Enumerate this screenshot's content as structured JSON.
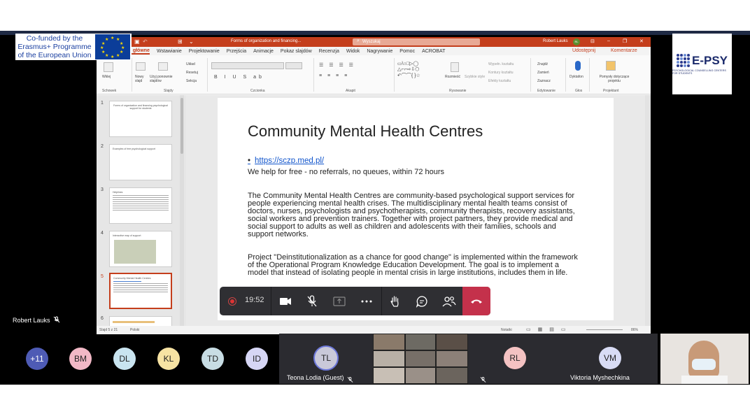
{
  "logos": {
    "eu_text": "Co-funded by the Erasmus+ Programme of the European Union",
    "epsy_name": "E-PSY",
    "epsy_sub": "PSYCHOLOGICAL COUNSELLING CENTERS FOR STUDENTS"
  },
  "ppt": {
    "doc_title": "Forms of organization and financing...",
    "search_placeholder": "Wyszukaj",
    "user_name": "Robert Lauks",
    "user_initials": "RL",
    "tabs": [
      "ndzia główne",
      "Wstawianie",
      "Projektowanie",
      "Przejścia",
      "Animacje",
      "Pokaz slajdów",
      "Recenzja",
      "Widok",
      "Nagrywanie",
      "Pomoc",
      "ACROBAT"
    ],
    "share_label": "Udostępnij",
    "comments_label": "Komentarze",
    "ribbon": {
      "paste": "Wklej",
      "new_slide": "Nowy slajd",
      "reuse": "Użyj ponownie slajdów",
      "layout": "Układ",
      "reset": "Resetuj",
      "section": "Sekcja",
      "arrange": "Rozmieść",
      "quick_styles": "Szybkie style",
      "fill": "Wypełn. kształtu",
      "outline": "Kontury kształtu",
      "effects": "Efekty kształtu",
      "find": "Znajdź",
      "replace": "Zamień",
      "select": "Zaznacz",
      "dictate": "Dyktafon",
      "ideas": "Pomysły dotyczące projektu",
      "groups": [
        "Schowek",
        "Slajdy",
        "Czcionka",
        "Akapit",
        "Rysowanie",
        "Edytowanie",
        "Głos",
        "Projektant"
      ]
    },
    "thumbnails": [
      {
        "num": "1",
        "text": "Forms of organization and financing psychological support for students"
      },
      {
        "num": "2",
        "text": "Examples of free psychological support"
      },
      {
        "num": "3",
        "text": "Helplines"
      },
      {
        "num": "4",
        "text": "Interactive map of support"
      },
      {
        "num": "5",
        "text": "Community Mental Health Centres"
      },
      {
        "num": "6",
        "text": ""
      }
    ],
    "status_slide": "Slajd 5 z 21",
    "status_lang": "Polski",
    "status_notes": "Notatki",
    "zoom": "86%"
  },
  "slide": {
    "title": "Community Mental Health Centres",
    "bullet": "•",
    "link": "https://sczp.med.pl/",
    "line1": "We help for free - no referrals, no queues, within 72 hours",
    "para1": "The Community Mental Health Centres are community-based psychological support services for people experiencing mental health crises. The multidisciplinary mental health teams consist of doctors, nurses, psychologists and psychotherapists, community therapists, recovery assistants, social workers and prevention trainers. Together with project partners, they provide medical and social support to adults as well as children and adolescents with their families, schools and support networks.",
    "para2": "Project \"Deinstitutionalization as a chance for good change\" is implemented within the framework of the Operational Program Knowledge Education Development. The goal is to implement a model that instead of isolating people in mental crisis in large institutions, includes them in life."
  },
  "call": {
    "timer": "19:52",
    "presenter": "Robert Lauks"
  },
  "participants": {
    "overflow": "+11",
    "circles": [
      {
        "initials": "BM",
        "color": "#f2b8c6"
      },
      {
        "initials": "DL",
        "color": "#c9e4f0"
      },
      {
        "initials": "KL",
        "color": "#f7e3a3"
      },
      {
        "initials": "TD",
        "color": "#c8dde4"
      },
      {
        "initials": "ID",
        "color": "#d6d6f5"
      }
    ],
    "teona_initials": "TL",
    "teona_name": "Teona Lodia (Guest)",
    "rl_initials": "RL",
    "vm_initials": "VM",
    "vm_name": "Viktoria Myshechkina"
  }
}
